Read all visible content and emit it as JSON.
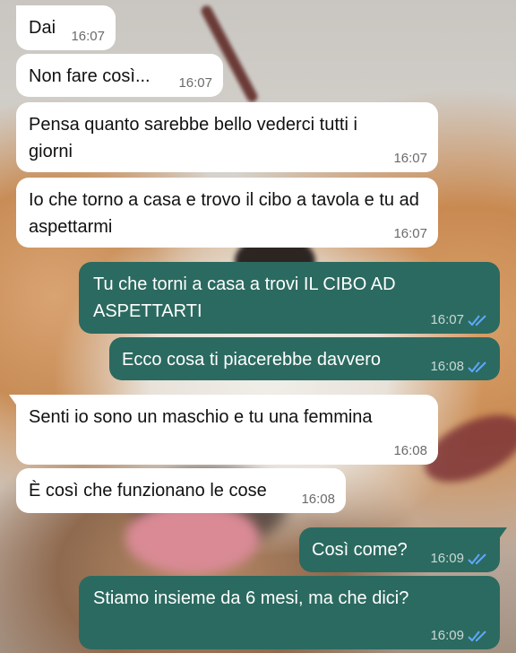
{
  "messages": [
    {
      "text": "Dai",
      "time": "16:07",
      "dir": "in"
    },
    {
      "text": "Non fare così...",
      "time": "16:07",
      "dir": "in"
    },
    {
      "text": "Pensa quanto sarebbe bello vederci tutti i giorni",
      "time": "16:07",
      "dir": "in"
    },
    {
      "text": "Io che torno a casa e trovo il cibo a tavola e tu ad aspettarmi",
      "time": "16:07",
      "dir": "in"
    },
    {
      "text": "Tu che torni a casa a trovi IL CIBO AD ASPETTARTI",
      "time": "16:07",
      "dir": "out",
      "status": "read"
    },
    {
      "text": "Ecco cosa ti piacerebbe davvero",
      "time": "16:08",
      "dir": "out",
      "status": "read"
    },
    {
      "text": "Senti io sono un maschio e tu una femmina",
      "time": "16:08",
      "dir": "in"
    },
    {
      "text": "È così che funzionano le cose",
      "time": "16:08",
      "dir": "in"
    },
    {
      "text": "Così come?",
      "time": "16:09",
      "dir": "out",
      "status": "read"
    },
    {
      "text": "Stiamo insieme da 6 mesi, ma che dici?",
      "time": "16:09",
      "dir": "out",
      "status": "read"
    }
  ],
  "colors": {
    "incoming_bubble": "#ffffff",
    "outgoing_bubble": "#2b6a60",
    "read_ticks": "#5fa8ff"
  },
  "icons": {
    "read_receipt": "double-check-icon"
  }
}
